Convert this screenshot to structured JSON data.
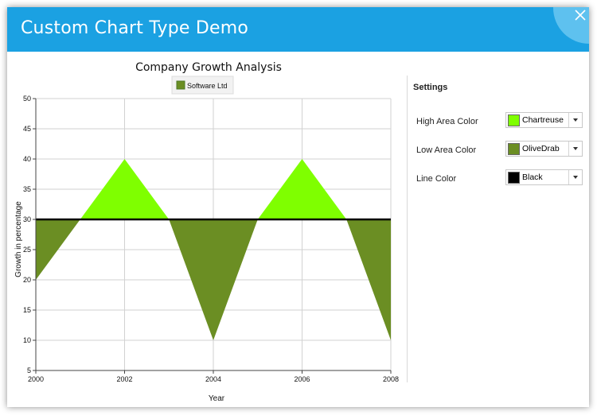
{
  "window": {
    "title": "Custom Chart Type Demo"
  },
  "settings": {
    "title": "Settings",
    "rows": [
      {
        "label": "High Area Color",
        "value": "Chartreuse",
        "color": "#7fff00"
      },
      {
        "label": "Low Area Color",
        "value": "OliveDrab",
        "color": "#6b8e23"
      },
      {
        "label": "Line Color",
        "value": "Black",
        "color": "#000000"
      }
    ]
  },
  "chart_data": {
    "type": "area",
    "title": "Company Growth Analysis",
    "xlabel": "Year",
    "ylabel": "Growth in percentage",
    "xlim": [
      2000,
      2008
    ],
    "ylim": [
      5,
      50
    ],
    "xticks": [
      2000,
      2002,
      2004,
      2006,
      2008
    ],
    "yticks": [
      5,
      10,
      15,
      20,
      25,
      30,
      35,
      40,
      45,
      50
    ],
    "baseline": 30,
    "grid": true,
    "legend_position": "top",
    "series": [
      {
        "name": "Software Ltd",
        "x": [
          2000,
          2001,
          2002,
          2003,
          2004,
          2005,
          2006,
          2007,
          2008
        ],
        "values": [
          20,
          30,
          40,
          30,
          10,
          30,
          40,
          30,
          10
        ]
      }
    ]
  }
}
